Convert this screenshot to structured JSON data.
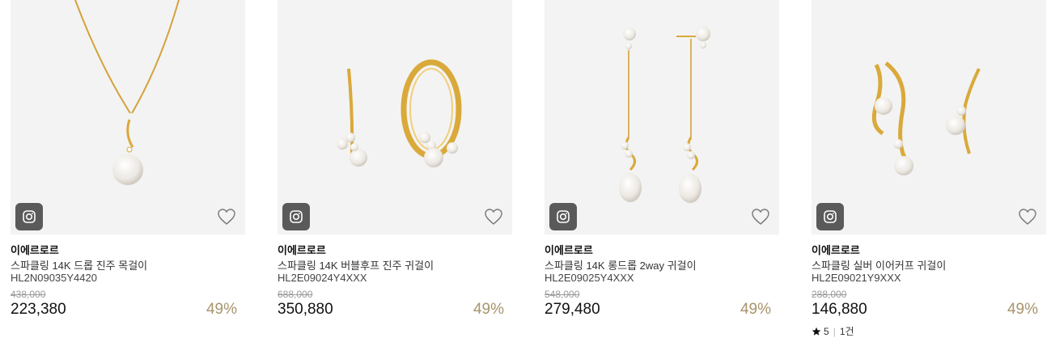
{
  "colors": {
    "discount": "#a8946b",
    "image_bg": "#f3f3f3",
    "icon_bg": "#5a5a5a",
    "gold": "#d9a93a"
  },
  "icons": {
    "photo": "camera-icon",
    "wishlist": "heart-icon",
    "star": "star-icon"
  },
  "products": [
    {
      "brand": "이에르로르",
      "name": "스파클링 14K 드롭 진주 목걸이",
      "code": "HL2N09035Y4420",
      "original_price": "438,000",
      "price": "223,380",
      "discount": "49%"
    },
    {
      "brand": "이에르로르",
      "name": "스파클링 14K 버블후프 진주 귀걸이",
      "code": "HL2E09024Y4XXX",
      "original_price": "688,000",
      "price": "350,880",
      "discount": "49%"
    },
    {
      "brand": "이에르로르",
      "name": "스파클링 14K 롱드롭 2way 귀걸이",
      "code": "HL2E09025Y4XXX",
      "original_price": "548,000",
      "price": "279,480",
      "discount": "49%"
    },
    {
      "brand": "이에르로르",
      "name": "스파클링 실버 이어커프 귀걸이",
      "code": "HL2E09021Y9XXX",
      "original_price": "288,000",
      "price": "146,880",
      "discount": "49%",
      "rating": {
        "score": "5",
        "reviews": "1건"
      }
    }
  ]
}
